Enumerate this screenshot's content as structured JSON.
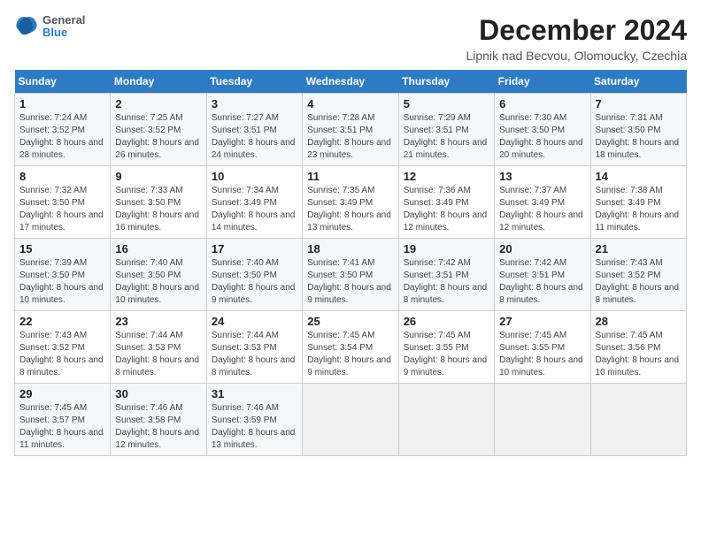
{
  "logo": {
    "line1": "General",
    "line2": "Blue"
  },
  "title": "December 2024",
  "subtitle": "Lipnik nad Becvou, Olomoucky, Czechia",
  "headers": [
    "Sunday",
    "Monday",
    "Tuesday",
    "Wednesday",
    "Thursday",
    "Friday",
    "Saturday"
  ],
  "weeks": [
    [
      {
        "day": "1",
        "sunrise": "Sunrise: 7:24 AM",
        "sunset": "Sunset: 3:52 PM",
        "daylight": "Daylight: 8 hours and 28 minutes."
      },
      {
        "day": "2",
        "sunrise": "Sunrise: 7:25 AM",
        "sunset": "Sunset: 3:52 PM",
        "daylight": "Daylight: 8 hours and 26 minutes."
      },
      {
        "day": "3",
        "sunrise": "Sunrise: 7:27 AM",
        "sunset": "Sunset: 3:51 PM",
        "daylight": "Daylight: 8 hours and 24 minutes."
      },
      {
        "day": "4",
        "sunrise": "Sunrise: 7:28 AM",
        "sunset": "Sunset: 3:51 PM",
        "daylight": "Daylight: 8 hours and 23 minutes."
      },
      {
        "day": "5",
        "sunrise": "Sunrise: 7:29 AM",
        "sunset": "Sunset: 3:51 PM",
        "daylight": "Daylight: 8 hours and 21 minutes."
      },
      {
        "day": "6",
        "sunrise": "Sunrise: 7:30 AM",
        "sunset": "Sunset: 3:50 PM",
        "daylight": "Daylight: 8 hours and 20 minutes."
      },
      {
        "day": "7",
        "sunrise": "Sunrise: 7:31 AM",
        "sunset": "Sunset: 3:50 PM",
        "daylight": "Daylight: 8 hours and 18 minutes."
      }
    ],
    [
      {
        "day": "8",
        "sunrise": "Sunrise: 7:32 AM",
        "sunset": "Sunset: 3:50 PM",
        "daylight": "Daylight: 8 hours and 17 minutes."
      },
      {
        "day": "9",
        "sunrise": "Sunrise: 7:33 AM",
        "sunset": "Sunset: 3:50 PM",
        "daylight": "Daylight: 8 hours and 16 minutes."
      },
      {
        "day": "10",
        "sunrise": "Sunrise: 7:34 AM",
        "sunset": "Sunset: 3:49 PM",
        "daylight": "Daylight: 8 hours and 14 minutes."
      },
      {
        "day": "11",
        "sunrise": "Sunrise: 7:35 AM",
        "sunset": "Sunset: 3:49 PM",
        "daylight": "Daylight: 8 hours and 13 minutes."
      },
      {
        "day": "12",
        "sunrise": "Sunrise: 7:36 AM",
        "sunset": "Sunset: 3:49 PM",
        "daylight": "Daylight: 8 hours and 12 minutes."
      },
      {
        "day": "13",
        "sunrise": "Sunrise: 7:37 AM",
        "sunset": "Sunset: 3:49 PM",
        "daylight": "Daylight: 8 hours and 12 minutes."
      },
      {
        "day": "14",
        "sunrise": "Sunrise: 7:38 AM",
        "sunset": "Sunset: 3:49 PM",
        "daylight": "Daylight: 8 hours and 11 minutes."
      }
    ],
    [
      {
        "day": "15",
        "sunrise": "Sunrise: 7:39 AM",
        "sunset": "Sunset: 3:50 PM",
        "daylight": "Daylight: 8 hours and 10 minutes."
      },
      {
        "day": "16",
        "sunrise": "Sunrise: 7:40 AM",
        "sunset": "Sunset: 3:50 PM",
        "daylight": "Daylight: 8 hours and 10 minutes."
      },
      {
        "day": "17",
        "sunrise": "Sunrise: 7:40 AM",
        "sunset": "Sunset: 3:50 PM",
        "daylight": "Daylight: 8 hours and 9 minutes."
      },
      {
        "day": "18",
        "sunrise": "Sunrise: 7:41 AM",
        "sunset": "Sunset: 3:50 PM",
        "daylight": "Daylight: 8 hours and 9 minutes."
      },
      {
        "day": "19",
        "sunrise": "Sunrise: 7:42 AM",
        "sunset": "Sunset: 3:51 PM",
        "daylight": "Daylight: 8 hours and 8 minutes."
      },
      {
        "day": "20",
        "sunrise": "Sunrise: 7:42 AM",
        "sunset": "Sunset: 3:51 PM",
        "daylight": "Daylight: 8 hours and 8 minutes."
      },
      {
        "day": "21",
        "sunrise": "Sunrise: 7:43 AM",
        "sunset": "Sunset: 3:52 PM",
        "daylight": "Daylight: 8 hours and 8 minutes."
      }
    ],
    [
      {
        "day": "22",
        "sunrise": "Sunrise: 7:43 AM",
        "sunset": "Sunset: 3:52 PM",
        "daylight": "Daylight: 8 hours and 8 minutes."
      },
      {
        "day": "23",
        "sunrise": "Sunrise: 7:44 AM",
        "sunset": "Sunset: 3:53 PM",
        "daylight": "Daylight: 8 hours and 8 minutes."
      },
      {
        "day": "24",
        "sunrise": "Sunrise: 7:44 AM",
        "sunset": "Sunset: 3:53 PM",
        "daylight": "Daylight: 8 hours and 8 minutes."
      },
      {
        "day": "25",
        "sunrise": "Sunrise: 7:45 AM",
        "sunset": "Sunset: 3:54 PM",
        "daylight": "Daylight: 8 hours and 9 minutes."
      },
      {
        "day": "26",
        "sunrise": "Sunrise: 7:45 AM",
        "sunset": "Sunset: 3:55 PM",
        "daylight": "Daylight: 8 hours and 9 minutes."
      },
      {
        "day": "27",
        "sunrise": "Sunrise: 7:45 AM",
        "sunset": "Sunset: 3:55 PM",
        "daylight": "Daylight: 8 hours and 10 minutes."
      },
      {
        "day": "28",
        "sunrise": "Sunrise: 7:45 AM",
        "sunset": "Sunset: 3:56 PM",
        "daylight": "Daylight: 8 hours and 10 minutes."
      }
    ],
    [
      {
        "day": "29",
        "sunrise": "Sunrise: 7:45 AM",
        "sunset": "Sunset: 3:57 PM",
        "daylight": "Daylight: 8 hours and 11 minutes."
      },
      {
        "day": "30",
        "sunrise": "Sunrise: 7:46 AM",
        "sunset": "Sunset: 3:58 PM",
        "daylight": "Daylight: 8 hours and 12 minutes."
      },
      {
        "day": "31",
        "sunrise": "Sunrise: 7:46 AM",
        "sunset": "Sunset: 3:59 PM",
        "daylight": "Daylight: 8 hours and 13 minutes."
      },
      null,
      null,
      null,
      null
    ]
  ]
}
